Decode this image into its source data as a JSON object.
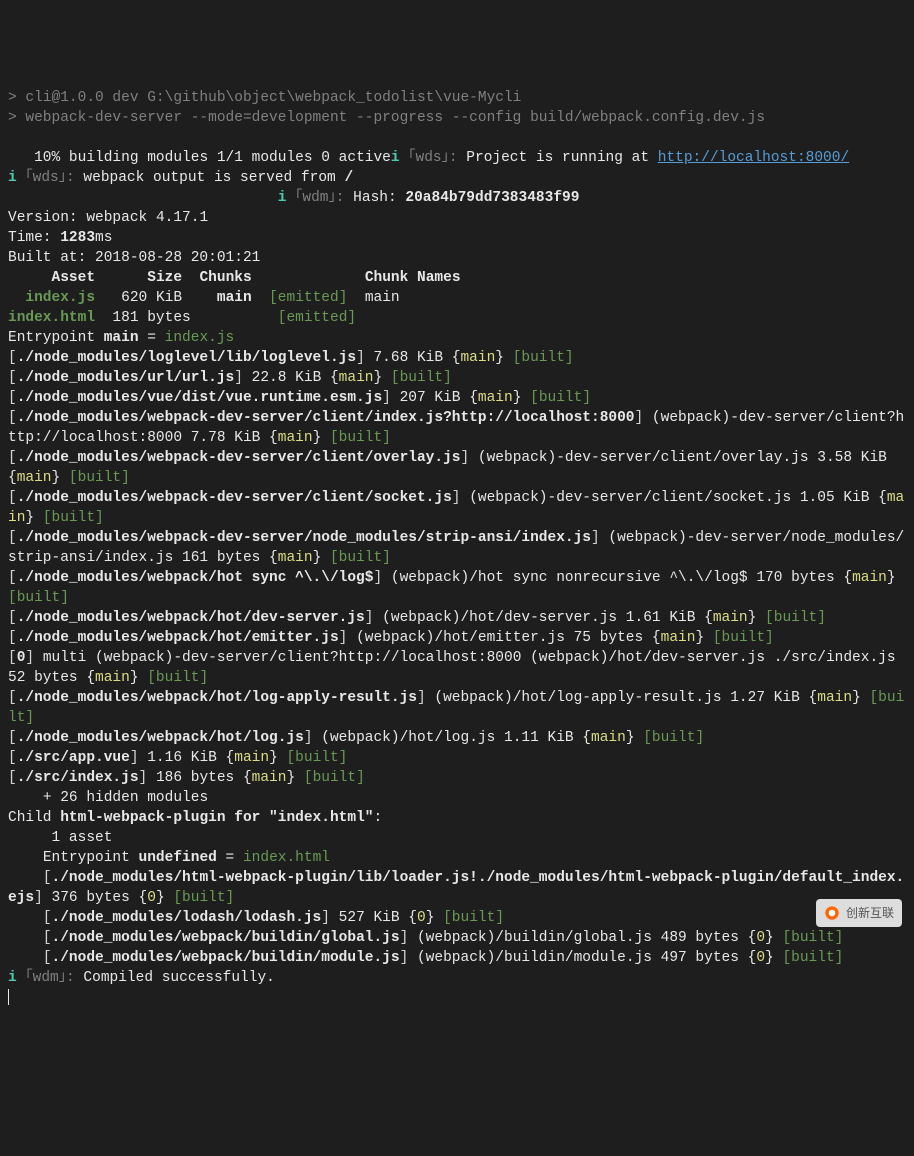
{
  "prompt1_prefix": "> ",
  "prompt1": "cli@1.0.0 dev G:\\github\\object\\webpack_todolist\\vue-Mycli",
  "prompt2_prefix": "> ",
  "prompt2": "webpack-dev-server --mode=development --progress --config build/webpack.config.dev.js",
  "build_pct": "   10% ",
  "build_msg": "building modules 1/1 modules 0 active",
  "wds_prefix_i": "i",
  "wds_tag": " ｢wds｣: ",
  "wds_running": "Project is running at ",
  "wds_url": "http://localhost:8000/",
  "wds_served": "webpack output is served from ",
  "wds_slash": "/",
  "wdm_tag": " ｢wdm｣: ",
  "wdm_hash_label": "Hash: ",
  "wdm_hash": "20a84b79dd7383483f99",
  "version_label": "Version: ",
  "version": "webpack 4.17.1",
  "time_label": "Time: ",
  "time": "1283",
  "time_unit": "ms",
  "built_at_label": "Built at: ",
  "built_at": "2018-08-28 20:01:21",
  "table_header": {
    "asset": "Asset",
    "size": "Size",
    "chunks": "Chunks",
    "names": "Chunk Names"
  },
  "assets": [
    {
      "name": "index.js",
      "size": "620 KiB",
      "chunk": "main",
      "emitted": "[emitted]",
      "chunk_name": "main"
    },
    {
      "name": "index.html",
      "size": "181 bytes",
      "chunk": "",
      "emitted": "[emitted]",
      "chunk_name": ""
    }
  ],
  "entrypoint_label": "Entrypoint ",
  "entrypoint_name": "main",
  "entrypoint_eq": " = ",
  "entrypoint_file": "index.js",
  "modules": [
    {
      "path": "./node_modules/loglevel/lib/loglevel.js",
      "info": "7.68 KiB {",
      "chunk": "main",
      "after": "} ",
      "built": "[built]"
    },
    {
      "path": "./node_modules/url/url.js",
      "info": "22.8 KiB {",
      "chunk": "main",
      "after": "} ",
      "built": "[built]"
    },
    {
      "path": "./node_modules/vue/dist/vue.runtime.esm.js",
      "info": "207 KiB {",
      "chunk": "main",
      "after": "} ",
      "built": "[built]"
    },
    {
      "path": "./node_modules/webpack-dev-server/client/index.js?http://localhost:8000",
      "info2": "(webpack)-dev-server/client?http://localhost:8000 7.78 KiB {",
      "chunk": "main",
      "after": "} ",
      "built": "[built]"
    },
    {
      "path": "./node_modules/webpack-dev-server/client/overlay.js",
      "info2": "(webpack)-dev-server/client/overlay.js 3.58 KiB {",
      "chunk": "main",
      "after": "} ",
      "built": "[built]"
    },
    {
      "path": "./node_modules/webpack-dev-server/client/socket.js",
      "info2": "(webpack)-dev-server/client/socket.js 1.05 KiB {",
      "chunk": "main",
      "after": "} ",
      "built": "[built]"
    },
    {
      "path": "./node_modules/webpack-dev-server/node_modules/strip-ansi/index.js",
      "info2": "(webpack)-dev-server/node_modules/strip-ansi/index.js 161 bytes {",
      "chunk": "main",
      "after": "} ",
      "built": "[built]"
    },
    {
      "path": "./node_modules/webpack/hot sync ^\\.\\/log$",
      "info2": "(webpack)/hot sync nonrecursive ^\\.\\/log$ 170 bytes {",
      "chunk": "main",
      "after": "} ",
      "built": "[built]"
    },
    {
      "path": "./node_modules/webpack/hot/dev-server.js",
      "info2": "(webpack)/hot/dev-server.js 1.61 KiB {",
      "chunk": "main",
      "after": "} ",
      "built": "[built]"
    },
    {
      "path": "./node_modules/webpack/hot/emitter.js",
      "info2": "(webpack)/hot/emitter.js 75 bytes {",
      "chunk": "main",
      "after": "} ",
      "built": "[built]"
    },
    {
      "zero": "0",
      "info3": "multi (webpack)-dev-server/client?http://localhost:8000 (webpack)/hot/dev-server.js ./src/index.js 52 bytes {",
      "chunk": "main",
      "after": "} ",
      "built": "[built]"
    },
    {
      "path": "./node_modules/webpack/hot/log-apply-result.js",
      "info2": "(webpack)/hot/log-apply-result.js 1.27 KiB {",
      "chunk": "main",
      "after": "} ",
      "built": "[built]"
    },
    {
      "path": "./node_modules/webpack/hot/log.js",
      "info2": "(webpack)/hot/log.js 1.11 KiB {",
      "chunk": "main",
      "after": "} ",
      "built": "[built]"
    },
    {
      "path": "./src/app.vue",
      "info": "1.16 KiB {",
      "chunk": "main",
      "after": "} ",
      "built": "[built]"
    },
    {
      "path": "./src/index.js",
      "info": "186 bytes {",
      "chunk": "main",
      "after": "} ",
      "built": "[built]"
    }
  ],
  "hidden": "    + 26 hidden modules",
  "child_label": "Child ",
  "child_name": "html-webpack-plugin for \"index.html\"",
  "child_asset": "     1 asset",
  "child_entry_label": "    Entrypoint ",
  "child_entry_name": "undefined",
  "child_entry_eq": " = ",
  "child_entry_file": "index.html",
  "child_modules": [
    {
      "path": "./node_modules/html-webpack-plugin/lib/loader.js!./node_modules/html-webpack-plugin/default_index.ejs",
      "info": "376 bytes {",
      "chunk": "0",
      "after": "} ",
      "built": "[built]"
    },
    {
      "path": "./node_modules/lodash/lodash.js",
      "info": "527 KiB {",
      "chunk": "0",
      "after": "} ",
      "built": "[built]"
    },
    {
      "path": "./node_modules/webpack/buildin/global.js",
      "info2": "(webpack)/buildin/global.js 489 bytes {",
      "chunk": "0",
      "after": "} ",
      "built": "[built]"
    },
    {
      "path": "./node_modules/webpack/buildin/module.js",
      "info2": "(webpack)/buildin/module.js 497 bytes {",
      "chunk": "0",
      "after": "} ",
      "built": "[built]"
    }
  ],
  "compiled": "Compiled successfully.",
  "watermark": "创新互联"
}
